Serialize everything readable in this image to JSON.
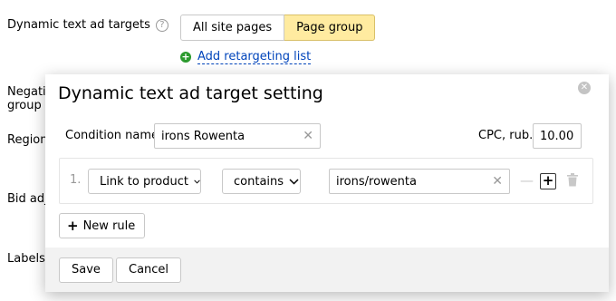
{
  "background": {
    "targets_label": "Dynamic text ad targets",
    "help_icon": "?",
    "segments": [
      "All site pages",
      "Page group"
    ],
    "active_segment": "Page group",
    "add_retargeting": "Add retargeting list",
    "partial_labels": {
      "negative": "Negativ",
      "group": "group",
      "regions": "Region",
      "bid": "Bid adju",
      "labels": "Labels"
    }
  },
  "modal": {
    "title": "Dynamic text ad target setting",
    "close_icon": "close-icon",
    "condition_label": "Condition name",
    "condition_value": "irons Rowenta",
    "cpc_label": "CPC, rub.",
    "cpc_value": "10.00",
    "rule": {
      "number": "1.",
      "field": "Link to product",
      "operator": "contains",
      "value": "irons/rowenta"
    },
    "new_rule_label": "New rule",
    "save_label": "Save",
    "cancel_label": "Cancel"
  },
  "colors": {
    "active_segment_bg": "#ffeba0",
    "link": "#0044bb",
    "add_icon": "#2c9a2e",
    "footer_bg": "#f2f2f2"
  }
}
